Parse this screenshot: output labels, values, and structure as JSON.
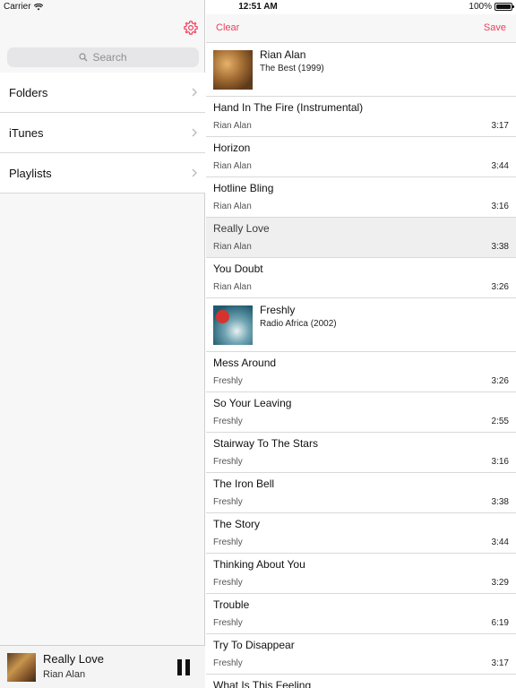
{
  "status_bar": {
    "carrier": "Carrier",
    "time": "12:51 AM",
    "battery": "100%"
  },
  "sidebar": {
    "search_placeholder": "Search",
    "items": [
      {
        "label": "Folders"
      },
      {
        "label": "iTunes"
      },
      {
        "label": "Playlists"
      }
    ]
  },
  "now_playing": {
    "title": "Really Love",
    "artist": "Rian Alan"
  },
  "toolbar": {
    "clear_label": "Clear",
    "save_label": "Save"
  },
  "albums": [
    {
      "artist": "Rian Alan",
      "album": "The Best (1999)",
      "tracks": [
        {
          "title": "Hand In The Fire (Instrumental)",
          "artist": "Rian Alan",
          "duration": "3:17"
        },
        {
          "title": "Horizon",
          "artist": "Rian Alan",
          "duration": "3:44"
        },
        {
          "title": "Hotline Bling",
          "artist": "Rian Alan",
          "duration": "3:16"
        },
        {
          "title": "Really Love",
          "artist": "Rian Alan",
          "duration": "3:38"
        },
        {
          "title": "You Doubt",
          "artist": "Rian Alan",
          "duration": "3:26"
        }
      ]
    },
    {
      "artist": "Freshly",
      "album": "Radio Africa (2002)",
      "tracks": [
        {
          "title": "Mess Around",
          "artist": "Freshly",
          "duration": "3:26"
        },
        {
          "title": "So Your Leaving",
          "artist": "Freshly",
          "duration": "2:55"
        },
        {
          "title": "Stairway To The Stars",
          "artist": "Freshly",
          "duration": "3:16"
        },
        {
          "title": "The Iron Bell",
          "artist": "Freshly",
          "duration": "3:38"
        },
        {
          "title": "The Story",
          "artist": "Freshly",
          "duration": "3:44"
        },
        {
          "title": "Thinking About You",
          "artist": "Freshly",
          "duration": "3:29"
        },
        {
          "title": "Trouble",
          "artist": "Freshly",
          "duration": "6:19"
        },
        {
          "title": "Try To Disappear",
          "artist": "Freshly",
          "duration": "3:17"
        },
        {
          "title": "What Is This Feeling",
          "artist": "",
          "duration": ""
        }
      ]
    }
  ],
  "colors": {
    "accent": "#ef3e5c",
    "selected_row": "#efeff0"
  }
}
